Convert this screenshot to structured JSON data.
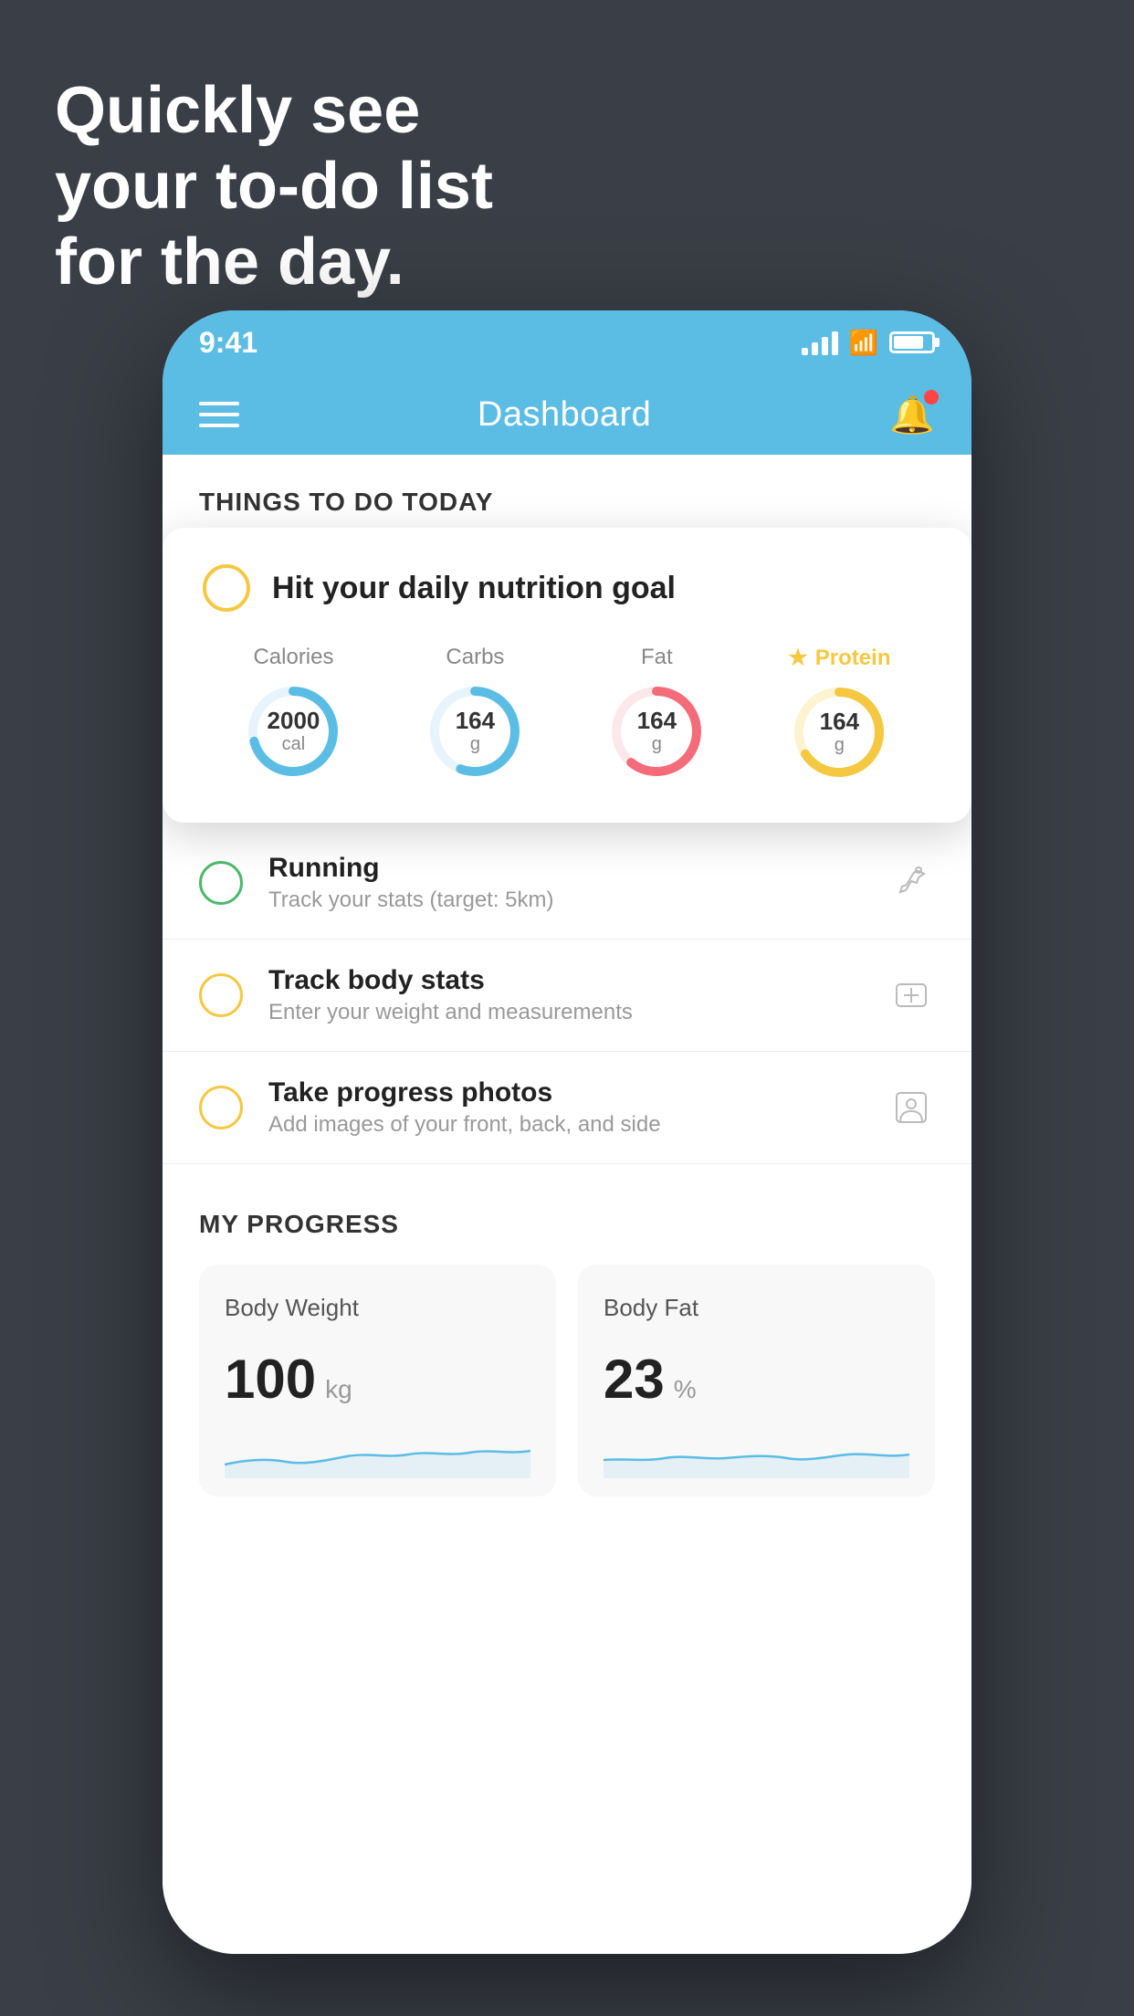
{
  "hero": {
    "line1": "Quickly see",
    "line2": "your to-do list",
    "line3": "for the day."
  },
  "status_bar": {
    "time": "9:41"
  },
  "nav": {
    "title": "Dashboard"
  },
  "todo_section": {
    "header": "THINGS TO DO TODAY",
    "card": {
      "title": "Hit your daily nutrition goal",
      "nutrients": [
        {
          "label": "Calories",
          "value": "2000",
          "unit": "cal",
          "color": "#5bbde4",
          "percent": 70
        },
        {
          "label": "Carbs",
          "value": "164",
          "unit": "g",
          "color": "#5bbde4",
          "percent": 55
        },
        {
          "label": "Fat",
          "value": "164",
          "unit": "g",
          "color": "#f46b7a",
          "percent": 60
        },
        {
          "label": "Protein",
          "value": "164",
          "unit": "g",
          "color": "#f5c842",
          "percent": 65,
          "star": true
        }
      ]
    },
    "items": [
      {
        "title": "Running",
        "sub": "Track your stats (target: 5km)",
        "circle": "green",
        "icon": "👟"
      },
      {
        "title": "Track body stats",
        "sub": "Enter your weight and measurements",
        "circle": "yellow",
        "icon": "⚖️"
      },
      {
        "title": "Take progress photos",
        "sub": "Add images of your front, back, and side",
        "circle": "yellow",
        "icon": "👤"
      }
    ]
  },
  "progress_section": {
    "title": "MY PROGRESS",
    "cards": [
      {
        "title": "Body Weight",
        "value": "100",
        "unit": "kg"
      },
      {
        "title": "Body Fat",
        "value": "23",
        "unit": "%"
      }
    ]
  }
}
